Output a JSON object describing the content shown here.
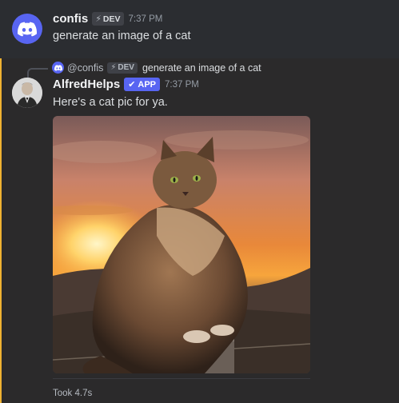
{
  "messages": [
    {
      "username": "confis",
      "tag": "DEV",
      "time": "7:37 PM",
      "text": "generate an image of a cat"
    },
    {
      "reply": {
        "username": "@confis",
        "tag": "DEV",
        "text": "generate an image of a cat"
      },
      "username": "AlfredHelps",
      "tag": "APP",
      "time": "7:37 PM",
      "text": "Here's a cat pic for ya.",
      "attachment_icon": "cat-photo",
      "footer": "Took 4.7s"
    }
  ],
  "colors": {
    "discord_blurple": "#5865f2",
    "highlight_bar": "#f0b232",
    "background": "#2b2d31"
  }
}
